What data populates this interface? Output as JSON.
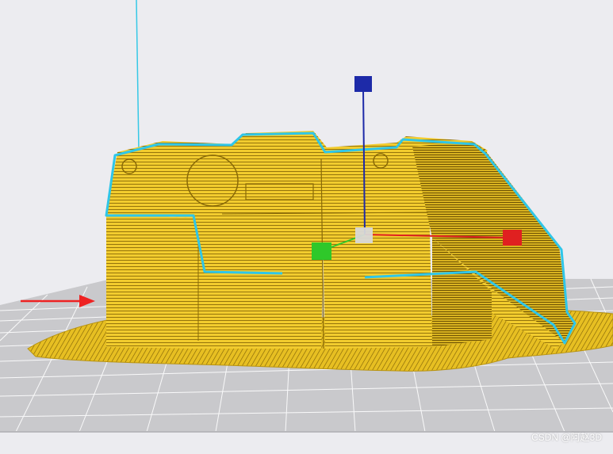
{
  "viewport": {
    "background_color": "#ececf0",
    "build_plate_color": "#c9c9cc",
    "grid_line_color": "#ffffff",
    "model_color": "#f2cc2e",
    "model_layer_line_color": "#8a6a06",
    "model_outline_color": "#2fc6e8",
    "vertical_guide_color": "#35c8e6",
    "gizmo": {
      "x_axis_handle_color": "#e02020",
      "y_axis_handle_color": "#2fc82a",
      "z_axis_handle_color": "#1d2aa8",
      "origin_handle_color": "#d8d8d8"
    },
    "direction_arrow_color": "#ee2222"
  },
  "watermark": {
    "text": "CSDN @阿赵3D"
  }
}
